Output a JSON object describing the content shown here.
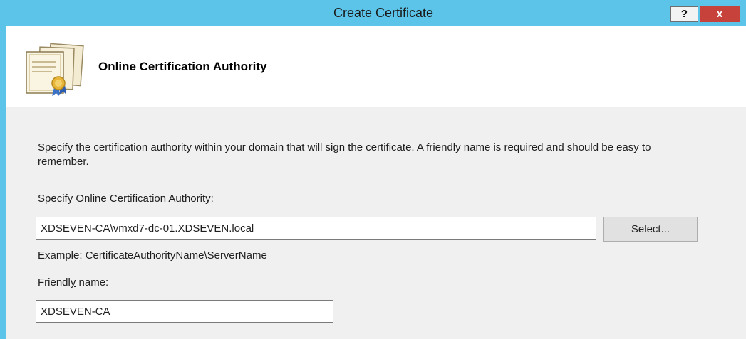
{
  "window": {
    "title": "Create Certificate",
    "help_label": "?",
    "close_label": "x"
  },
  "header": {
    "title": "Online Certification Authority"
  },
  "content": {
    "description": "Specify the certification authority within your domain that will sign the certificate. A friendly name is required and should be easy to remember.",
    "ca_label_prefix": "Specify ",
    "ca_label_access": "O",
    "ca_label_suffix": "nline Certification Authority:",
    "ca_value": "XDSEVEN-CA\\vmxd7-dc-01.XDSEVEN.local",
    "select_label": "Select...",
    "example_text": "Example: CertificateAuthorityName\\ServerName",
    "friendly_label_prefix": "Friendl",
    "friendly_label_access": "y",
    "friendly_label_suffix": " name:",
    "friendly_value": "XDSEVEN-CA"
  },
  "colors": {
    "titlebar": "#5bc4e8",
    "close": "#c7423b",
    "content_bg": "#f0f0f0"
  },
  "icons": [
    "certificate-icon",
    "help-icon",
    "close-icon"
  ]
}
